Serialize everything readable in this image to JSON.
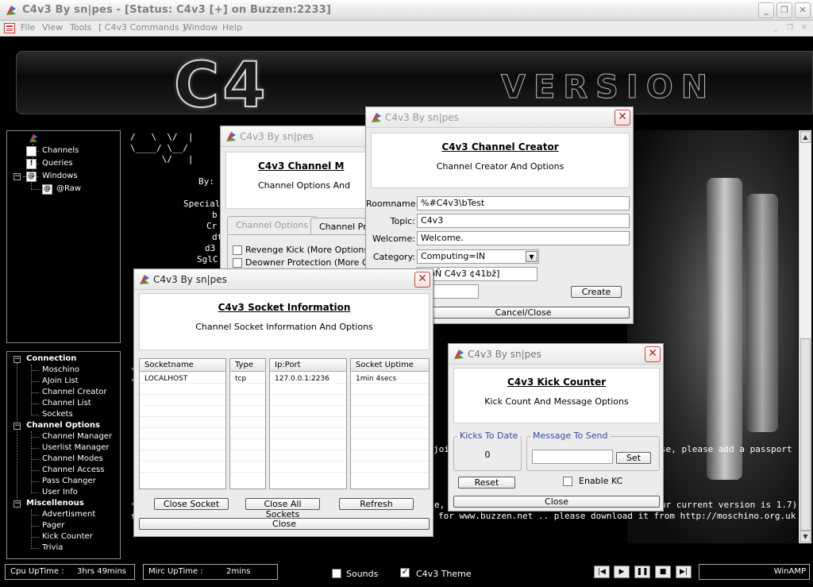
{
  "window": {
    "title": "C4v3 By sn|pes - [Status: C4v3 [+] on Buzzen:2233]"
  },
  "menu": [
    "File",
    "View",
    "Tools",
    "[ C4v3 Commands ]",
    "Window",
    "Help"
  ],
  "banner": {
    "logo_text": "C4",
    "version_text": "VERSION"
  },
  "tree": {
    "channels": "Channels",
    "queries": "Queries",
    "windows": "Windows",
    "raw": "@Raw"
  },
  "nav": {
    "connection": "Connection",
    "connection_items": [
      "Moschino",
      "AJoin List",
      "Channel Creator",
      "Channel List",
      "Sockets"
    ],
    "channel_options": "Channel Options",
    "channel_items": [
      "Channel Manager",
      "Userlist Manager",
      "Channel Modes",
      "Channel Access",
      "Pass Changer",
      "User Info"
    ],
    "misc": "Miscellenous",
    "misc_items": [
      "Advertisment",
      "Pager",
      "Kick Counter",
      "Trivia"
    ]
  },
  "chat": {
    "line1": "/   \\  \\/  |",
    "line2": "\\____/ \\__/",
    "line3": "      \\/   |",
    "by": "By:",
    "special": "Special",
    "frag1": "b",
    "frag2": "Cr",
    "frag3": "dt",
    "frag4": "d3",
    "frag5": "SglC",
    "join_msg": "joi",
    "passport_msg": "se, please add a passport",
    "version_msg": "e, v",
    "current_msg": "ur current version is 1.7)",
    "buzzen_msg": "for www.buzzen.net .. please download it from http://moschino.org.uk .."
  },
  "status": {
    "cpu_label": "Cpu UpTime :",
    "cpu_value": "3hrs 49mins",
    "mirc_label": "Mirc UpTime :",
    "mirc_value": "2mins",
    "sounds": "Sounds",
    "theme": "C4v3 Theme",
    "winamp": "WinAMP"
  },
  "dialog_title": "C4v3 By sn|pes",
  "channel_manager": {
    "heading": "C4v3 Channel M",
    "sub": "Channel Options And",
    "tab1": "Channel Options",
    "tab2": "Channel Pro",
    "opt1": "Revenge Kick (More Options In I",
    "opt2": "Deowner Protection (More Optic"
  },
  "channel_creator": {
    "heading": "C4v3 Channel Creator",
    "sub": "Channel Creator And Options",
    "roomname_label": "Roomname:",
    "roomname_value": "%#C4v3\\bTest",
    "topic_label": "Topic:",
    "topic_value": "C4v3",
    "welcome_label": "Welcome:",
    "welcome_value": "Welcome.",
    "category_label": "Category:",
    "category_value": "Computing=IN",
    "extra_value": "@bÑ C4v3 ¢41bž]",
    "create_button": "Create",
    "cancel_button": "Cancel/Close"
  },
  "socket_info": {
    "heading": "C4v3 Socket Information",
    "sub": "Channel Socket Information And Options",
    "columns": [
      "Socketname",
      "Type",
      "Ip:Port",
      "Socket Uptime"
    ],
    "rows": [
      [
        "LOCALHOST",
        "tcp",
        "127.0.0.1:2236",
        "1min 4secs"
      ]
    ],
    "close_socket": "Close Socket",
    "close_all": "Close All Sockets",
    "refresh": "Refresh",
    "close": "Close"
  },
  "kick_counter": {
    "heading": "C4v3 Kick Counter",
    "sub": "Kick Count And Message Options",
    "kicks_label": "Kicks To Date",
    "kicks_value": "0",
    "message_label": "Message To Send",
    "set_button": "Set",
    "reset_button": "Reset",
    "enable_label": "Enable KC",
    "close_button": "Close"
  },
  "colors": {
    "accent_red": "#b3271a",
    "group_label_blue": "#2d4f9e",
    "theme_check": "#1a6c1a"
  }
}
